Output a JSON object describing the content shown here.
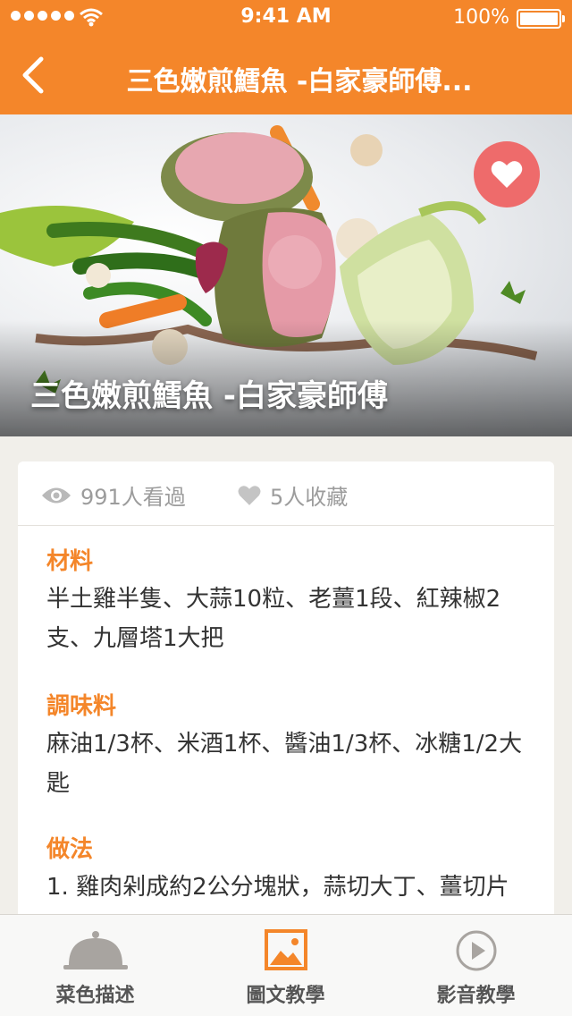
{
  "status_bar": {
    "time": "9:41 AM",
    "battery": "100%"
  },
  "nav": {
    "title": "三色嫩煎鱈魚 -白家豪師傅..."
  },
  "hero": {
    "title": "三色嫩煎鱈魚 -白家豪師傅"
  },
  "stats": {
    "views": "991人看過",
    "favorites": "5人收藏"
  },
  "sections": [
    {
      "heading": "材料",
      "body": "半土雞半隻、大蒜10粒、老薑1段、紅辣椒2支、九層塔1大把"
    },
    {
      "heading": "調味料",
      "body": "麻油1/3杯、米酒1杯、醬油1/3杯、冰糖1/2大匙"
    },
    {
      "heading": "做法",
      "body": "1. 雞肉剁成約2公分塊狀，蒜切大丁、薑切片"
    }
  ],
  "tabs": [
    {
      "label": "菜色描述",
      "icon": "cloche-icon"
    },
    {
      "label": "圖文教學",
      "icon": "image-icon"
    },
    {
      "label": "影音教學",
      "icon": "play-icon"
    }
  ],
  "colors": {
    "accent": "#f4862a",
    "favorite": "#ee6b6b"
  }
}
